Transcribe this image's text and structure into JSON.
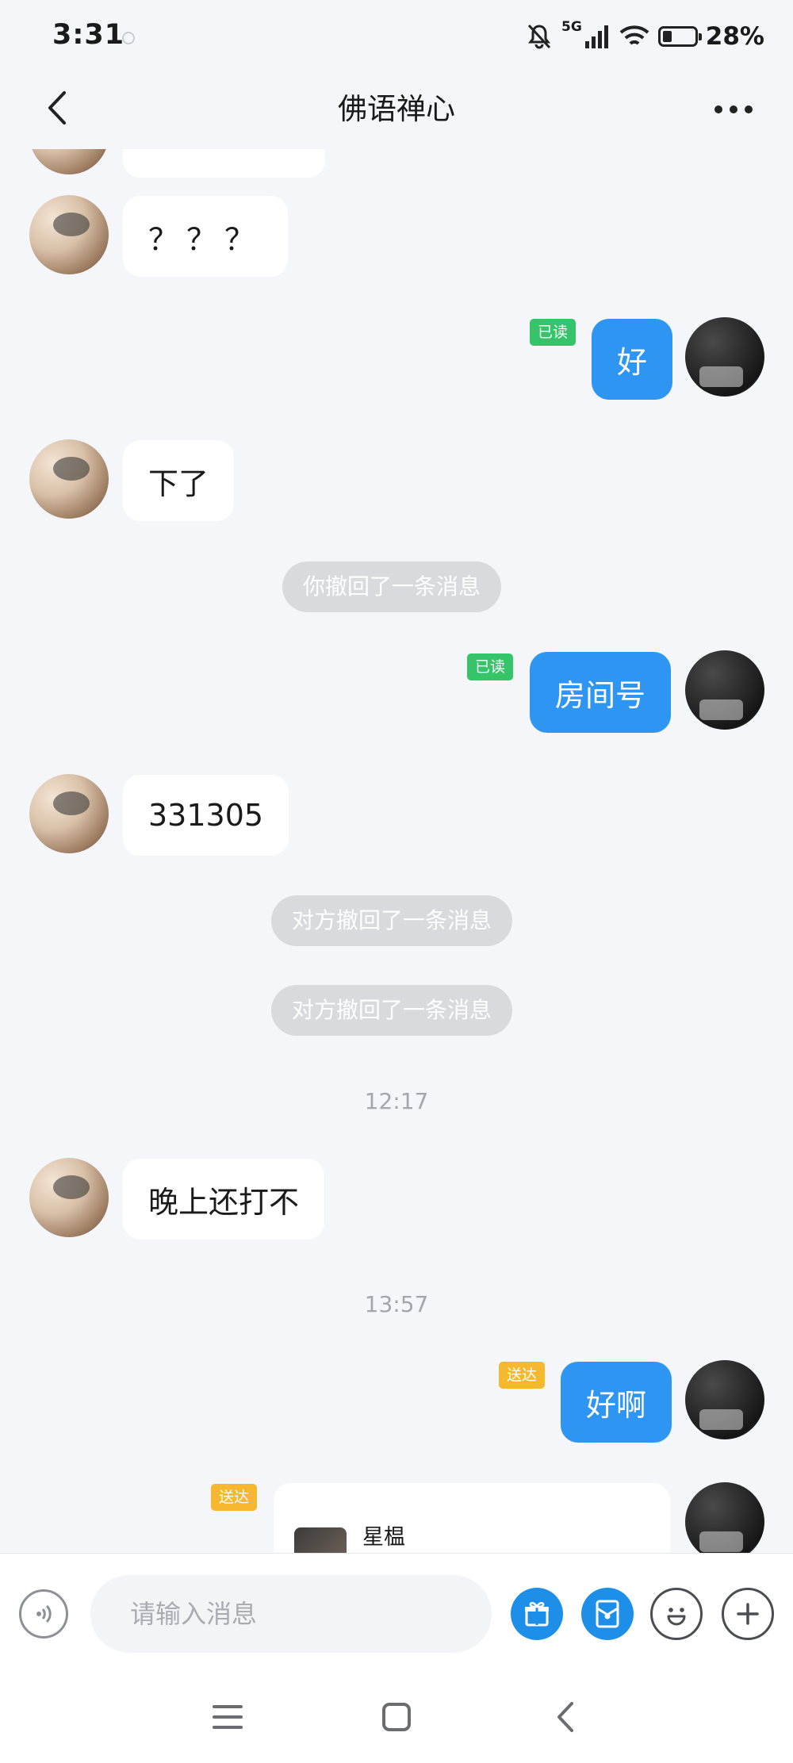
{
  "status_bar": {
    "time": "3:31",
    "network": "5G",
    "battery_percent": "28%",
    "battery_level": 0.28
  },
  "header": {
    "title": "佛语禅心",
    "back_icon": "chevron-left-icon",
    "more_icon": "more-dots-icon"
  },
  "messages": {
    "m1": {
      "side": "other",
      "text": "？？？"
    },
    "m2": {
      "side": "me",
      "text": "好",
      "status": "已读"
    },
    "m3": {
      "side": "other",
      "text": "下了"
    },
    "sys1": "你撤回了一条消息",
    "m4": {
      "side": "me",
      "text": "房间号",
      "status": "已读"
    },
    "m5": {
      "side": "other",
      "text": "331305"
    },
    "sys2": "对方撤回了一条消息",
    "sys3": "对方撤回了一条消息",
    "time1": "12:17",
    "m6": {
      "side": "other",
      "text": "晚上还打不"
    },
    "time2": "13:57",
    "m7": {
      "side": "me",
      "text": "好啊",
      "status": "送达"
    },
    "m8": {
      "side": "me",
      "card_name": "星榅",
      "status": "送达"
    }
  },
  "input_bar": {
    "placeholder": "请输入消息",
    "icons": [
      "voice-icon",
      "gift-icon",
      "red-packet-icon",
      "emoji-icon",
      "plus-icon"
    ]
  },
  "nav_bar": {
    "icons": [
      "menu-icon",
      "home-icon",
      "back-icon"
    ]
  },
  "colors": {
    "background": "#f4f6fa",
    "my_bubble": "#2f95f3",
    "read_tag": "#35c46a",
    "sent_tag": "#f5b82e",
    "recall_pill": "#d9dadd"
  }
}
